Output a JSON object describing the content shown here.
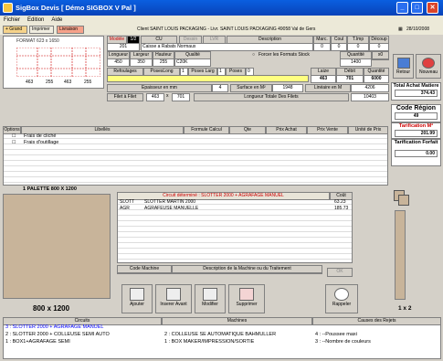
{
  "window": {
    "title": "SigBox Devis [ Démo SIGBOX V Pal ]",
    "min": "_",
    "max": "□",
    "close": "✕"
  },
  "menu": [
    "Fichier",
    "Edition",
    "Aide"
  ],
  "toolbar": {
    "grand": "+ Grand",
    "imprimer": "Imprimer",
    "livraison": "Livraison",
    "client": "Client SAINT LOUIS PACKAGING  -  Livr. SAINT LOUIS PACKAGING 49058 Val de Gers",
    "date": "28/10/2008"
  },
  "format": {
    "label": "FORMAT 623 x 1650",
    "dims": [
      "463",
      "255",
      "463",
      "255"
    ]
  },
  "modele": {
    "label": "Modèle",
    "num": "1/2",
    "cu": "CU",
    "dessin": "Dessin",
    "lvr": "LVR",
    "desc_hdr": "Description",
    "code": "201",
    "desc": "Caisse a Rabats Normaux",
    "marc_h": "Marc.",
    "coul_h": "Coul",
    "timp_h": "T.Imp",
    "decoup_h": "Découp",
    "marc": "0",
    "coul": "0",
    "timp": "0",
    "decoup": "0"
  },
  "dims": {
    "longueur_h": "Longueur",
    "largeur_h": "Largeur",
    "hauteur_h": "Hauteur",
    "qualite_h": "Qualité",
    "longueur": "450",
    "largeur": "350",
    "hauteur": "255",
    "qualite": "C20K",
    "forcer": "Forcer les Formats Stock",
    "quantite_h": "Quantité",
    "x0_h": "x0",
    "quantite": "1400"
  },
  "refoul": {
    "refoulages": "Refoulages",
    "poseslong": "PosesLong",
    "poses_larg": "Poses Larg",
    "poses": "Poses",
    "pl": "1",
    "plarg": "1",
    "poses_val": "0",
    "laize_h": "Laize",
    "debit_h": "Débit",
    "quantite_h": "Quantité",
    "laize": "463",
    "debit": "701",
    "quantite": "6000"
  },
  "epaisseur": {
    "label": "Epaisseur en mm",
    "val": "4",
    "surface_h": "Surface en M²",
    "surface": "1948",
    "lineaire_h": "Linéaire en M",
    "lineaire": "4206"
  },
  "filet": {
    "label": "Filet à Filet",
    "a": "463",
    "x": "x",
    "b": "701",
    "ltf_h": "Longueur Totale Des Filets",
    "ltf": "10403"
  },
  "side": {
    "retour": "Retour",
    "nouveau": "Nouveau",
    "total_h": "Total Achat Matiere",
    "total": "374.43",
    "code_region_h": "Code Région",
    "code_region": "49",
    "tarif_m2_h": "Tarification M²",
    "tarif_m2": "201.99",
    "tarif_forfait_h": "Tarification Forfait",
    "tarif_forfait": "0.00"
  },
  "options": {
    "hdr": [
      "Options",
      "Libellés",
      "Formule Calcul",
      "Qte",
      "Prix Achat",
      "Prix Vente",
      "Unité de Prix"
    ],
    "rows": [
      "Frais de cliché",
      "Frais d'outillage"
    ]
  },
  "palette": {
    "title": "1 PALETTE 800 X 1200",
    "size": "800 x 1200",
    "count": "1 x 2"
  },
  "circuit": {
    "title": "Circuit déterminé : SLOTTER 2000 + AGRAFAGE MANUEL",
    "cout_h": "Coût",
    "rows": [
      {
        "code": "SLOTT",
        "name": "SLOTTER MARTIN 2000",
        "cout": "63.23"
      },
      {
        "code": "AGR",
        "name": "AGRAFEUSE MANUELLE",
        "cout": "185.73"
      }
    ],
    "code_machine_h": "Code Machine",
    "desc_machine_h": "Description de la Machine ou du Traitement",
    "ok": "OK"
  },
  "actions": {
    "ajouter": "Ajouter",
    "inserer": "Inserer Avant",
    "modifier": "Modifier",
    "supprimer": "Supprimer",
    "rappeler": "Rappeler"
  },
  "bottom": {
    "circuits_h": "Circuits",
    "machines_h": "Machines",
    "causes_h": "Causes des Rejets",
    "circuits": [
      "3 : SLOTTER 2000 + AGRAFAGE MANUEL",
      "2 : SLOTTER 2000 + COLLEUSE SEMI AUTO",
      "1 : BOX1+AGRAFAGE SEMI"
    ],
    "machines": [
      "2 : COLLEUSE SE AUTOMATIQUE BAHMULLER",
      "1 : BOX MAKER/IMPRESSION/SORTIE"
    ],
    "causes": [
      "4 : --Poussee maxi",
      "3 : --Nombre de couleurs"
    ]
  }
}
